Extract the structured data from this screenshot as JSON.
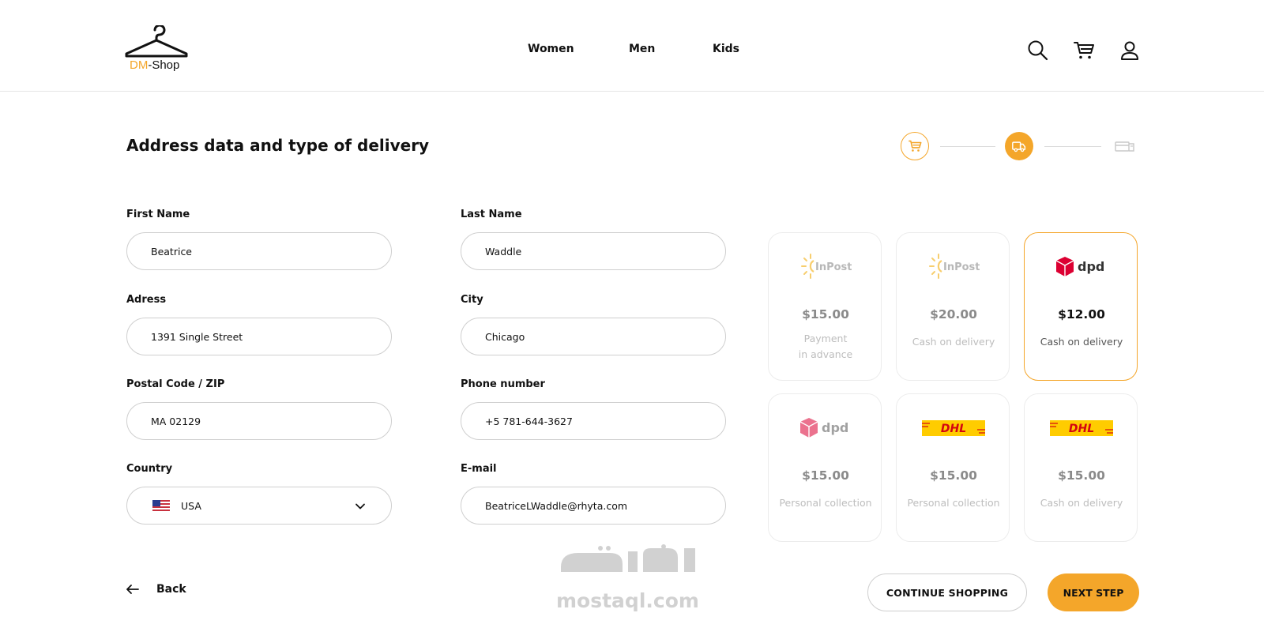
{
  "brand": {
    "part1": "DM",
    "part2": "-Shop",
    "accent": "#f4a62a"
  },
  "nav": {
    "women": "Women",
    "men": "Men",
    "kids": "Kids"
  },
  "header_icons": [
    "search-icon",
    "cart-icon",
    "user-icon"
  ],
  "page_title": "Address data and type of delivery",
  "steps": [
    {
      "icon": "cart-icon",
      "state": "done"
    },
    {
      "icon": "delivery-truck-icon",
      "state": "active"
    },
    {
      "icon": "payment-icon",
      "state": "pending"
    }
  ],
  "form": {
    "first_name": {
      "label": "First Name",
      "value": "Beatrice"
    },
    "last_name": {
      "label": "Last Name",
      "value": "Waddle"
    },
    "address": {
      "label": "Adress",
      "value": "1391 Single Street"
    },
    "city": {
      "label": "City",
      "value": "Chicago"
    },
    "postal": {
      "label": "Postal Code / ZIP",
      "value": "MA 02129"
    },
    "phone": {
      "label": "Phone number",
      "value": "+5 781-644-3627"
    },
    "country": {
      "label": "Country",
      "value": "USA",
      "flag": "us-flag-icon"
    },
    "email": {
      "label": "E-mail",
      "value": "BeatriceLWaddle@rhyta.com"
    }
  },
  "delivery": [
    {
      "carrier": "InPost",
      "price": "$15.00",
      "desc1": "Payment",
      "desc2": "in advance",
      "selected": false
    },
    {
      "carrier": "InPost",
      "price": "$20.00",
      "desc1": "Cash on delivery",
      "selected": false
    },
    {
      "carrier": "dpd",
      "price": "$12.00",
      "desc1": "Cash on delivery",
      "selected": true
    },
    {
      "carrier": "dpd",
      "price": "$15.00",
      "desc1": "Personal collection",
      "selected": false
    },
    {
      "carrier": "DHL",
      "price": "$15.00",
      "desc1": "Personal collection",
      "selected": false
    },
    {
      "carrier": "DHL",
      "price": "$15.00",
      "desc1": "Cash on delivery",
      "selected": false
    }
  ],
  "actions": {
    "back": "Back",
    "continue": "CONTINUE SHOPPING",
    "next": "NEXT STEP"
  },
  "watermark": {
    "text": "mostaql.com"
  }
}
